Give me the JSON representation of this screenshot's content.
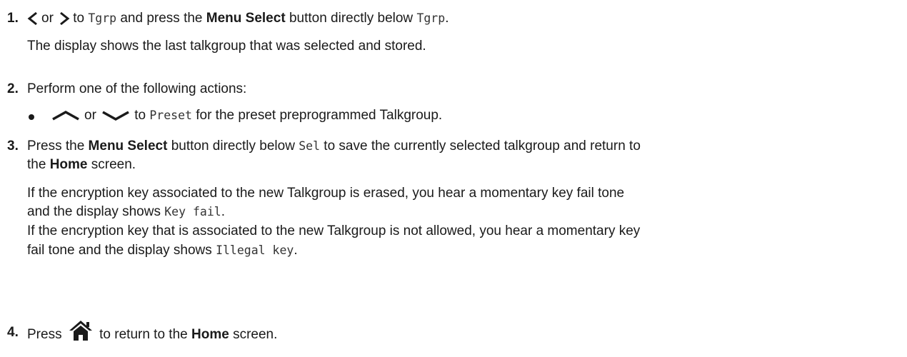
{
  "steps": [
    {
      "number": "1.",
      "or_text": "or",
      "to_text": "to",
      "code_tgrp": "Tgrp",
      "and_press_text": "and press the",
      "menu_select": "Menu Select",
      "directly_below_text": "button directly below",
      "code_tgrp_2": "Tgrp",
      "period": ".",
      "result": "The display shows the last talkgroup that was selected and stored."
    },
    {
      "number": "2.",
      "text": "Perform one of the following actions:",
      "bullet": {
        "or_text": "or",
        "to_text": "to",
        "code_preset": "Preset",
        "rest": "for the preset preprogrammed Talkgroup."
      }
    },
    {
      "number": "3.",
      "press_the": "Press the",
      "menu_select": "Menu Select",
      "directly_below": "button directly below",
      "code_sel": "Sel",
      "to_save": "to save the currently selected talkgroup and return to",
      "the": "the",
      "home": "Home",
      "screen": "screen.",
      "note1_a": "If the encryption key associated to the new Talkgroup is erased, you hear a momentary key fail tone",
      "note1_b": "and the display shows",
      "code_key_fail": "Key fail",
      "note2_a": "If the encryption key that is associated to the new Talkgroup is not allowed, you hear a momentary key",
      "note2_b": "fail tone and the display shows",
      "code_illegal_key": "Illegal key",
      "period": "."
    },
    {
      "number": "4.",
      "press": "Press",
      "to_return": "to return to the",
      "home": "Home",
      "screen": "screen."
    }
  ],
  "icons": {
    "left": "chevron-left-icon",
    "right": "chevron-right-icon",
    "up": "chevron-up-icon",
    "down": "chevron-down-icon",
    "home": "home-icon"
  }
}
